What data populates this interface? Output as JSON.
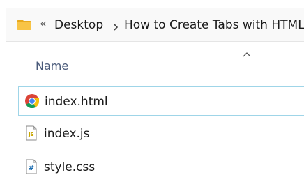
{
  "address_bar": {
    "overflow_glyph": "«",
    "breadcrumbs": [
      {
        "label": "Desktop"
      },
      {
        "label": "How to Create Tabs with HTML"
      }
    ],
    "separator_icon": "chevron-right-icon",
    "location_icon": "folder-icon"
  },
  "file_list": {
    "columns": [
      {
        "label": "Name",
        "sort": "ascending"
      }
    ],
    "files": [
      {
        "name": "index.html",
        "icon": "chrome-icon",
        "selected": true
      },
      {
        "name": "index.js",
        "icon": "js-file-icon",
        "selected": false
      },
      {
        "name": "style.css",
        "icon": "css-file-icon",
        "selected": false
      }
    ]
  },
  "colors": {
    "folder": "#f8c446",
    "selection_border": "#9fd5e8",
    "header_text": "#4a5a7a",
    "chrome_red": "#db4437",
    "chrome_yellow": "#f4c20d",
    "chrome_green": "#0f9d58",
    "chrome_blue": "#4285f4",
    "js_badge": "#c8a600",
    "css_badge": "#1f6fb2"
  }
}
